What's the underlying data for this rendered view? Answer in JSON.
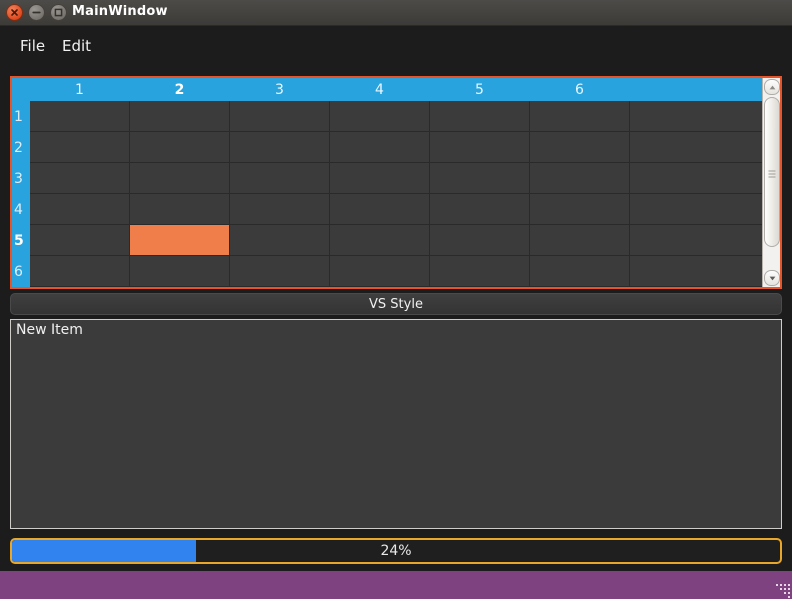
{
  "window": {
    "title": "MainWindow",
    "buttons": [
      {
        "name": "close",
        "glyph": "×"
      },
      {
        "name": "minimize",
        "glyph": "–"
      },
      {
        "name": "maximize",
        "glyph": "□"
      }
    ]
  },
  "menubar": {
    "items": [
      {
        "label": "File"
      },
      {
        "label": "Edit"
      }
    ]
  },
  "table": {
    "column_headers": [
      "1",
      "2",
      "3",
      "4",
      "5",
      "6"
    ],
    "row_headers": [
      "1",
      "2",
      "3",
      "4",
      "5",
      "6"
    ],
    "selected_column": "2",
    "selected_row": "5",
    "selected_cell": {
      "row": "5",
      "column": "2"
    },
    "header_color": "#29a3de",
    "selection_color": "#ef7e4a",
    "frame_border_color": "#e8542a",
    "cell_background": "#3b3b3b",
    "cells": [
      [
        "",
        "",
        "",
        "",
        "",
        ""
      ],
      [
        "",
        "",
        "",
        "",
        "",
        ""
      ],
      [
        "",
        "",
        "",
        "",
        "",
        ""
      ],
      [
        "",
        "",
        "",
        "",
        "",
        ""
      ],
      [
        "",
        "",
        "",
        "",
        "",
        ""
      ],
      [
        "",
        "",
        "",
        "",
        "",
        ""
      ]
    ],
    "scrollbar": {
      "up_arrow": "scroll-up-arrow",
      "down_arrow": "scroll-down-arrow",
      "thumb": "scroll-thumb"
    }
  },
  "style_button": {
    "label": "VS Style"
  },
  "list": {
    "items": [
      {
        "label": "New Item"
      }
    ]
  },
  "progress": {
    "value": 24,
    "text": "24%",
    "fill_color": "#3183ef",
    "border_color": "#e8a62a"
  },
  "statusbar": {
    "color": "#7e4281",
    "grip": "resize-grip"
  }
}
